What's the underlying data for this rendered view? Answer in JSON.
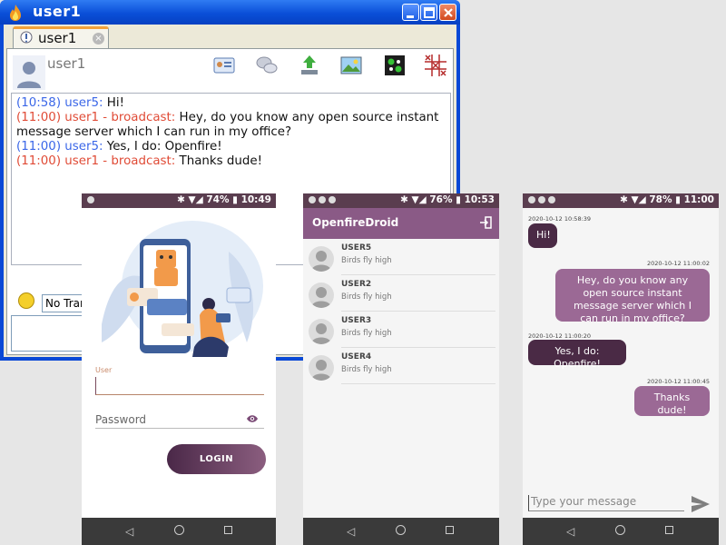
{
  "desktop": {
    "title": "user1",
    "tab_label": "user1",
    "tab_close": "×",
    "chat_user": "user1",
    "transport": "No Tran",
    "messages": [
      {
        "ts": "(10:58) user5: ",
        "text": "Hi!",
        "from": "in"
      },
      {
        "ts": "(11:00) user1 - broadcast: ",
        "text": "Hey, do you know any open source instant message server which I can run in my office?",
        "from": "out"
      },
      {
        "ts": "(11:00) user5: ",
        "text": "Yes, I do: Openfire!",
        "from": "in"
      },
      {
        "ts": "(11:00) user1 - broadcast: ",
        "text": "Thanks dude!",
        "from": "out"
      }
    ]
  },
  "phone1": {
    "status_battery": "74%",
    "status_time": "10:49",
    "user_hint": "User",
    "password_hint": "Password",
    "login_label": "LOGIN"
  },
  "phone2": {
    "status_battery": "76%",
    "status_time": "10:53",
    "app_title": "OpenfireDroid",
    "contacts": [
      {
        "name": "USER5",
        "status": "Birds fly high"
      },
      {
        "name": "USER2",
        "status": "Birds fly high"
      },
      {
        "name": "USER3",
        "status": "Birds fly high"
      },
      {
        "name": "USER4",
        "status": "Birds fly high"
      }
    ]
  },
  "phone3": {
    "status_battery": "78%",
    "status_time": "11:00",
    "messages": [
      {
        "stamp": "2020-10-12 10:58:39",
        "text": "Hi!",
        "from": "in"
      },
      {
        "stamp": "2020-10-12 11:00:02",
        "text": "Hey, do you know any open source instant message server which I can run in my office?",
        "from": "out"
      },
      {
        "stamp": "2020-10-12 11:00:20",
        "text": "Yes, I do: Openfire!",
        "from": "in"
      },
      {
        "stamp": "2020-10-12 11:00:45",
        "text": "Thanks dude!",
        "from": "out"
      }
    ],
    "compose_placeholder": "Type your message"
  },
  "colors": {
    "xp_blue": "#0a49d6",
    "timestamp_in": "#3b67e8",
    "timestamp_out": "#e04b36",
    "accent_purple": "#8a5a86",
    "bubble_in": "#4a2a45",
    "bubble_out": "#9b6995"
  },
  "icons": [
    "flame-icon",
    "minimize-icon",
    "maximize-icon",
    "close-icon",
    "chat-tab-icon",
    "avatar-icon",
    "vcard-icon",
    "chat-bubbles-icon",
    "transfer-icon",
    "picture-icon",
    "game-icon",
    "tictactoe-icon",
    "smiley-icon",
    "eye-icon",
    "exit-icon",
    "send-icon"
  ]
}
